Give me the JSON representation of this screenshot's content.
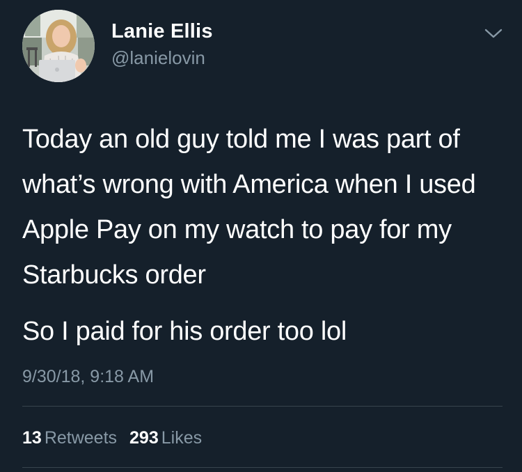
{
  "tweet": {
    "author": {
      "display_name": "Lanie Ellis",
      "handle": "@lanielovin",
      "avatar_icon": "profile-photo"
    },
    "menu_icon": "chevron-down-icon",
    "text_paragraphs": [
      "Today an old guy told me I was part of what’s wrong with America when I used Apple Pay on my watch to pay for my Starbucks order",
      "So I paid for his order too lol"
    ],
    "timestamp": "9/30/18, 9:18 AM",
    "stats": {
      "retweets_count": "13",
      "retweets_label": "Retweets",
      "likes_count": "293",
      "likes_label": "Likes"
    }
  },
  "colors": {
    "background": "#15202b",
    "primary_text": "#ffffff",
    "secondary_text": "#8899a6",
    "divider": "#38444d"
  }
}
